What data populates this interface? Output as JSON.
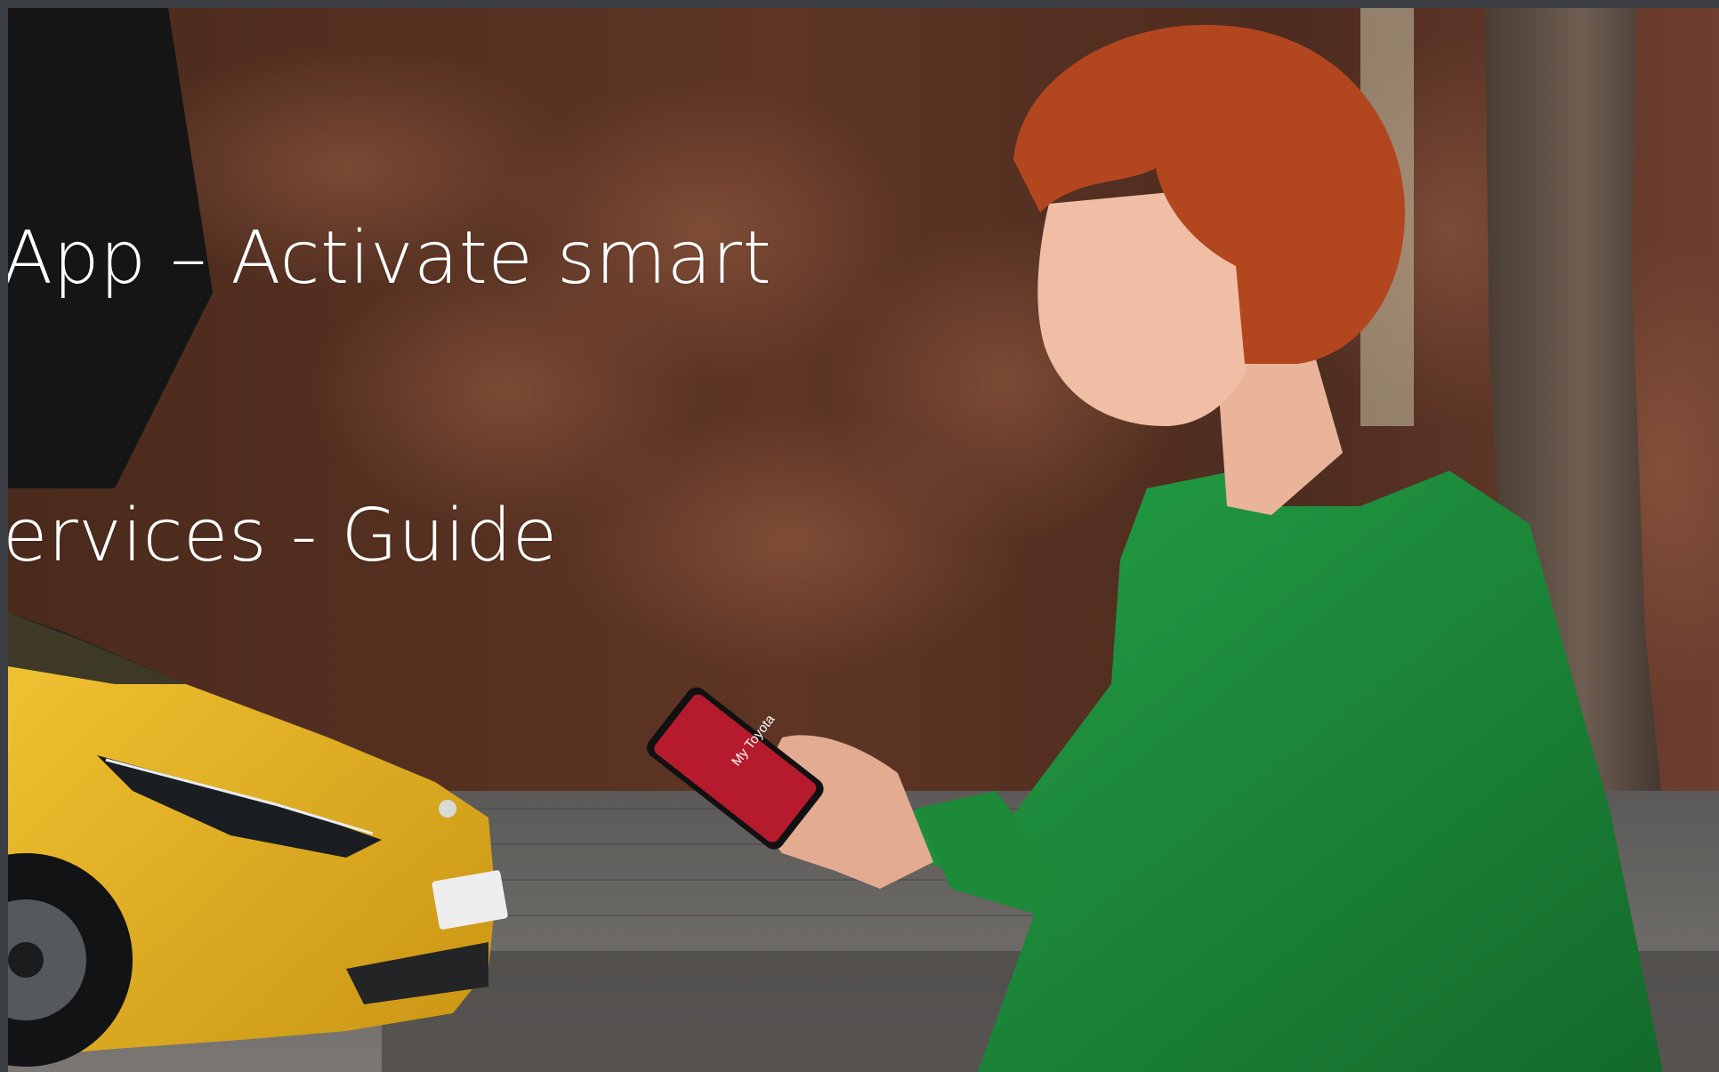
{
  "hero": {
    "title_line1": "App – Activate smart",
    "title_line2": "ervices - Guide",
    "phone_screen_text": "My Toyota"
  },
  "colors": {
    "wall": "#5a3322",
    "car": "#e6b21e",
    "sweater": "#1e8a3a",
    "hair": "#b2471f",
    "phone_screen": "#b51b2d",
    "pavement": "#6b6b6b"
  },
  "icons": {
    "car": "toyota-car-illustration",
    "person": "woman-with-phone-illustration",
    "phone": "smartphone-icon"
  }
}
